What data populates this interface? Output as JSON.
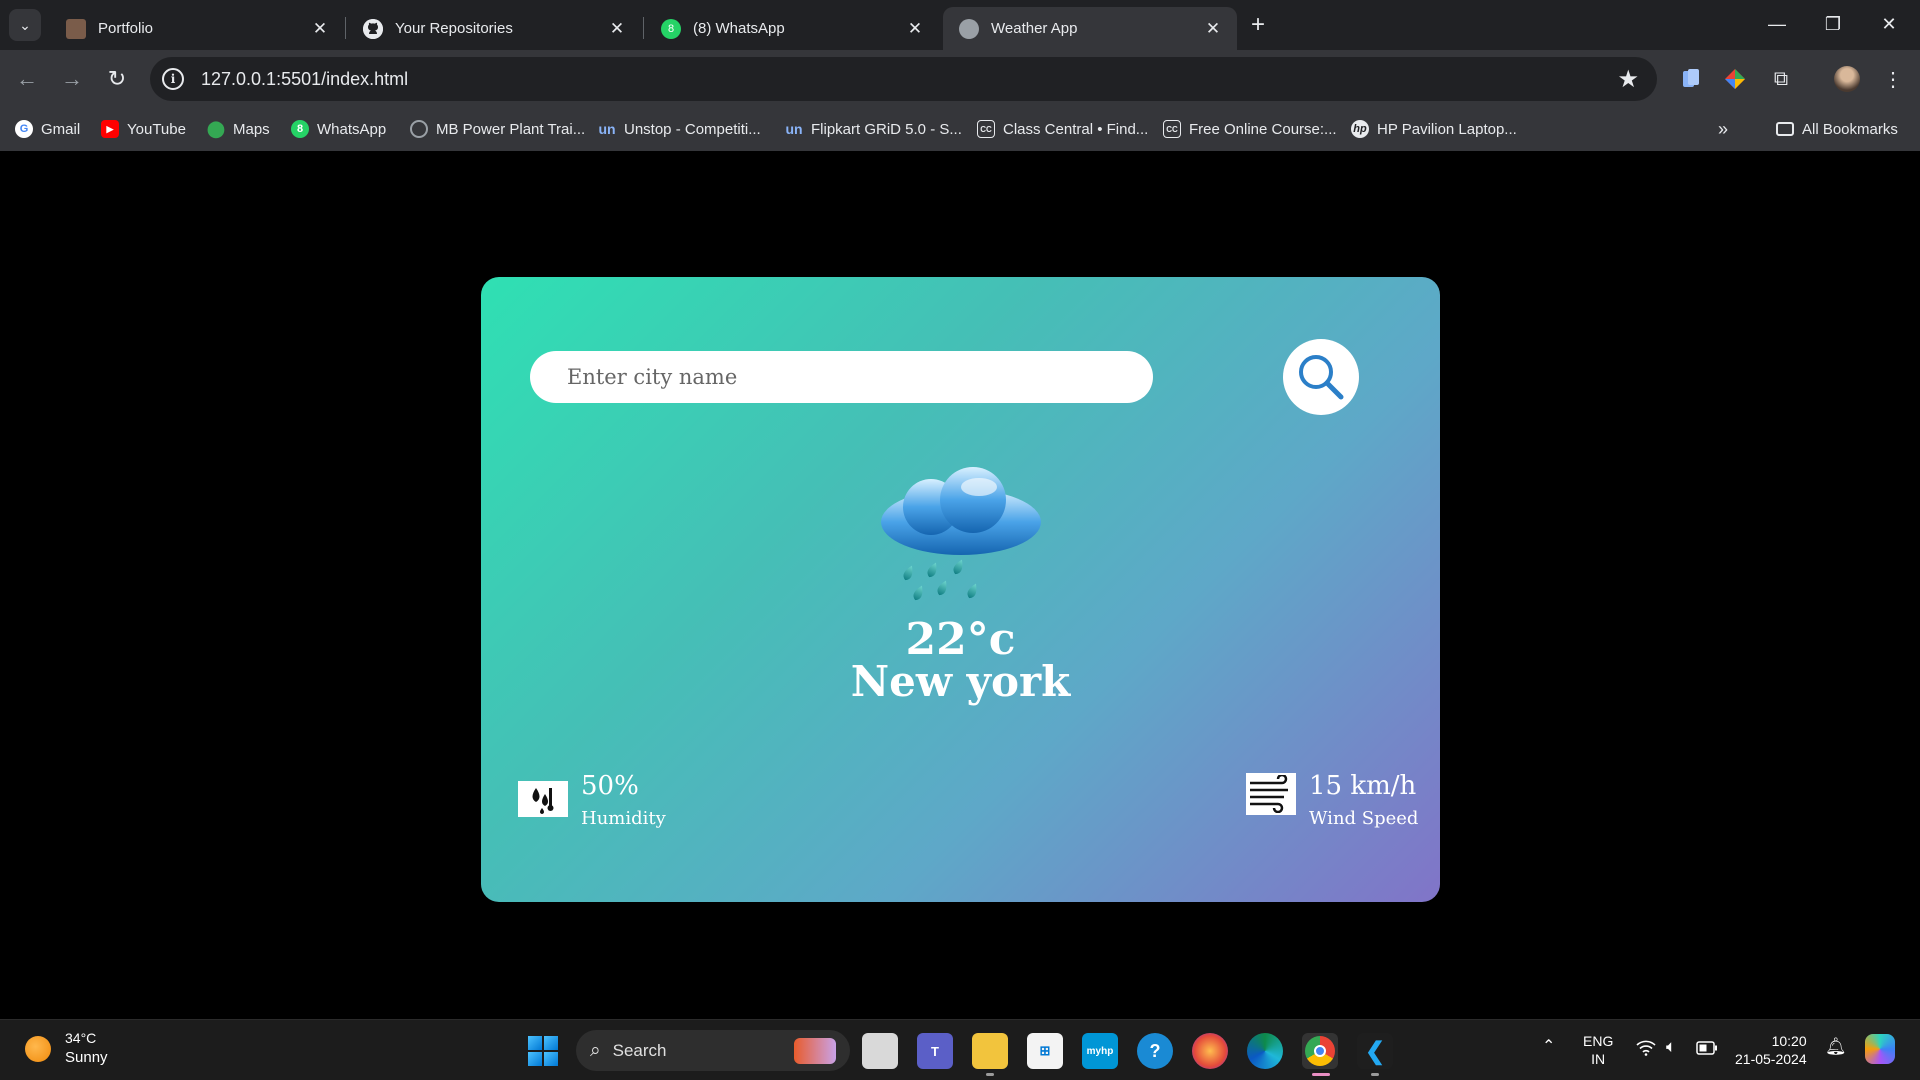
{
  "browser": {
    "tabs": [
      {
        "title": "Portfolio",
        "icon": "portfolio-favicon"
      },
      {
        "title": "Your Repositories",
        "icon": "github-icon"
      },
      {
        "title": "(8) WhatsApp",
        "icon": "whatsapp-icon"
      },
      {
        "title": "Weather App",
        "icon": "globe-icon",
        "active": true
      }
    ],
    "url": "127.0.0.1:5501/index.html",
    "bookmarks": [
      {
        "label": "Gmail",
        "icon": "google-icon"
      },
      {
        "label": "YouTube",
        "icon": "youtube-icon"
      },
      {
        "label": "Maps",
        "icon": "maps-icon"
      },
      {
        "label": "WhatsApp",
        "icon": "whatsapp-icon"
      },
      {
        "label": "MB Power Plant Trai...",
        "icon": "chatgpt-icon"
      },
      {
        "label": "Unstop - Competiti...",
        "icon": "unstop-icon"
      },
      {
        "label": "Flipkart GRiD 5.0 - S...",
        "icon": "unstop-icon"
      },
      {
        "label": "Class Central • Find...",
        "icon": "classcentral-icon"
      },
      {
        "label": "Free Online Course:...",
        "icon": "classcentral-icon"
      },
      {
        "label": "HP Pavilion Laptop...",
        "icon": "hp-icon"
      }
    ],
    "all_bookmarks_label": "All Bookmarks"
  },
  "weather_app": {
    "search_placeholder": "Enter city name",
    "temperature": "22°c",
    "city": "New york",
    "humidity_value": "50%",
    "humidity_label": "Humidity",
    "wind_value": "15 km/h",
    "wind_label": "Wind Speed",
    "weather_icon": "rain-cloud-icon",
    "gradient_colors": [
      "#2fe0b3",
      "#8174c8"
    ]
  },
  "taskbar": {
    "weather_temp": "34°C",
    "weather_desc": "Sunny",
    "search_label": "Search",
    "lang_line1": "ENG",
    "lang_line2": "IN",
    "time": "10:20",
    "date": "21-05-2024"
  }
}
